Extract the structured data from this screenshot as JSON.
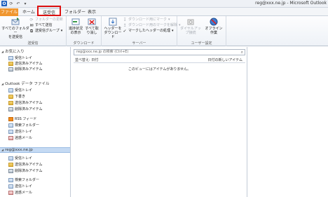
{
  "titlebar": {
    "title": "reg@xxx.ne.jp - Microsoft Outlook"
  },
  "tabs": {
    "file": "ファイル",
    "home": "ホーム",
    "send_receive": "送受信",
    "folder": "フォルダー",
    "view": "表示"
  },
  "ribbon": {
    "send_receive_group": {
      "label": "送受信",
      "send_receive_all": "すべてのフォルダー\nを送受信",
      "update_folder": "フォルダーの更新",
      "send_all": "すべて送信",
      "send_receive_groups": "送受信グループ"
    },
    "download_group": {
      "label": "ダウンロード",
      "show_progress": "進捗状況の表示",
      "cancel_all": "すべて取り消し"
    },
    "server_group": {
      "label": "サーバー",
      "download_headers": "ヘッダーを\nダウンロード",
      "mark_download": "ダウンロード用にマーク",
      "unmark_download": "ダウンロード用のマークを解除",
      "process_marked": "マークしたヘッダーの処理"
    },
    "user_group": {
      "label": "ユーザー設定",
      "dialup": "ダイヤルアップ接続",
      "offline": "オフライン作業"
    }
  },
  "nav": {
    "favorites_header": "お気に入り",
    "favorites": [
      "受信トレイ",
      "送信済みアイテム",
      "削除済みアイテム"
    ],
    "datafile_header": "Outlook データ ファイル",
    "datafile": [
      "受信トレイ",
      "下書き",
      "送信済みアイテム",
      "削除済みアイテム",
      "RSS フィード",
      "検索フォルダー",
      "送信トレイ",
      "迷惑メール"
    ],
    "account_header": "reg@xxx.ne.jp",
    "account": [
      "受信トレイ",
      "送信済みアイテム",
      "削除済みアイテム",
      "検索フォルダー",
      "送信トレイ",
      "迷惑メール"
    ]
  },
  "mail_list": {
    "search_placeholder": "reg@xxx.ne.jp の検索 (Ctrl+E)",
    "sort_label": "並べ替え: 日付",
    "newer_label": "日付の新しいアイテム",
    "empty_message": "このビューにはアイテムがありません。"
  }
}
